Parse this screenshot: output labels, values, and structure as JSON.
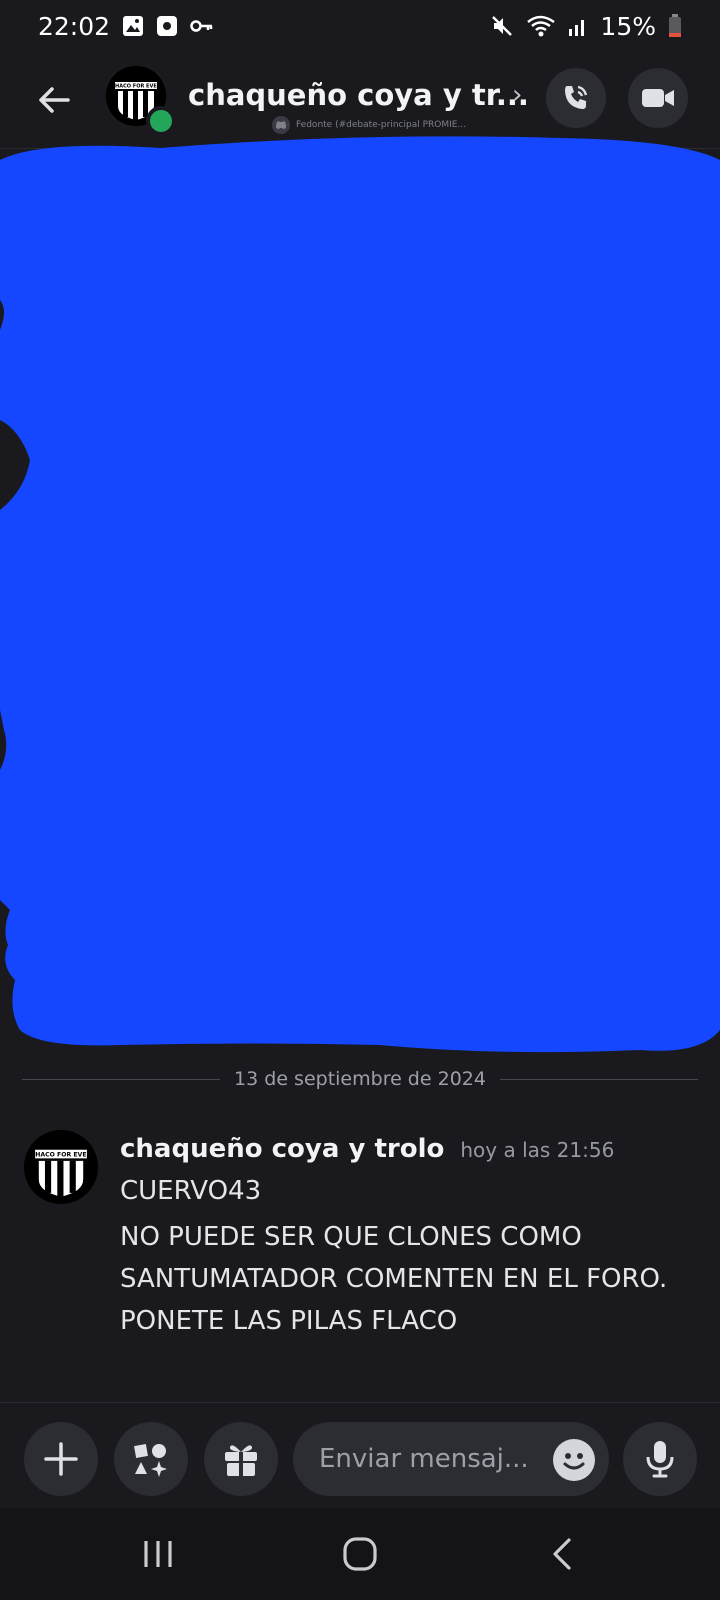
{
  "status_bar": {
    "time": "22:02",
    "left_icons": [
      "gallery-icon",
      "media-icon",
      "vpn-key-icon"
    ],
    "right_icons": [
      "mute-icon",
      "wifi-icon",
      "signal-icon"
    ],
    "battery": "15%",
    "battery_color": "#e5533d"
  },
  "header": {
    "title": "chaqueño coya y tr...",
    "subtitle": "Fedonte (#debate-principal PROMIE...",
    "avatar_text": "CHACO FOR EVER",
    "status_color": "#23a55a"
  },
  "redaction": {
    "color": "#1447ff"
  },
  "date_separator": "13 de septiembre de 2024",
  "message": {
    "author": "chaqueño coya y trolo",
    "time": "hoy a las 21:56",
    "avatar_text": "CHACO FOR EVER",
    "lines": [
      "CUERVO43",
      "NO PUEDE SER QUE CLONES COMO",
      "SANTUMATADOR COMENTEN EN EL FORO.",
      "PONETE LAS PILAS FLACO"
    ]
  },
  "composer": {
    "placeholder": "Enviar mensaj..."
  },
  "colors": {
    "background": "#1a1a1e",
    "surface": "#2b2d33",
    "online": "#23a55a"
  }
}
